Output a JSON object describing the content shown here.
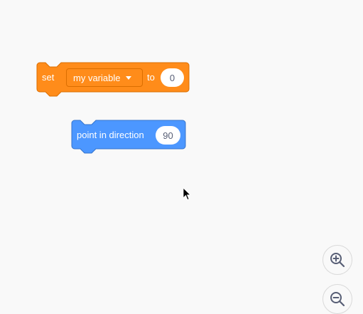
{
  "blocks": {
    "set_variable": {
      "label_set": "set",
      "variable": "my variable",
      "label_to": "to",
      "value": "0",
      "color": "#ff8c1a"
    },
    "point_in_direction": {
      "label": "point in direction",
      "value": "90",
      "color": "#4c97ff"
    }
  },
  "zoom": {
    "in_icon": "zoom-in-icon",
    "out_icon": "zoom-out-icon"
  }
}
